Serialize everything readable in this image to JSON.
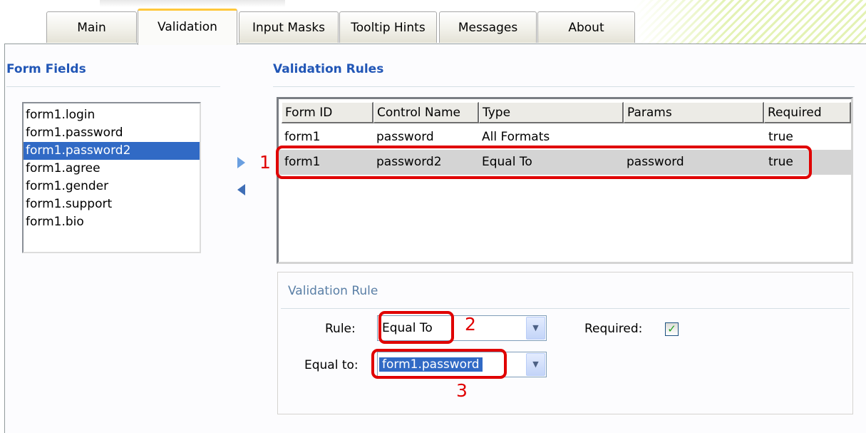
{
  "tabs": [
    "Main",
    "Validation",
    "Input Masks",
    "Tooltip Hints",
    "Messages",
    "About"
  ],
  "active_tab": "Validation",
  "form_fields": {
    "title": "Form Fields",
    "items": [
      "form1.login",
      "form1.password",
      "form1.password2",
      "form1.agree",
      "form1.gender",
      "form1.support",
      "form1.bio"
    ],
    "selected": "form1.password2"
  },
  "validation_rules": {
    "title": "Validation Rules",
    "columns": [
      "Form ID",
      "Control Name",
      "Type",
      "Params",
      "Required"
    ],
    "rows": [
      {
        "form_id": "form1",
        "control_name": "password",
        "type": "All Formats",
        "params": "",
        "required": "true"
      },
      {
        "form_id": "form1",
        "control_name": "password2",
        "type": "Equal To",
        "params": "password",
        "required": "true"
      }
    ],
    "selected_row": 1
  },
  "rule_editor": {
    "title": "Validation Rule",
    "rule_label": "Rule:",
    "rule_value": "Equal To",
    "required_label": "Required:",
    "required_checked": true,
    "equal_to_label": "Equal to:",
    "equal_to_value": "form1.password"
  },
  "annotations": [
    "1",
    "2",
    "3"
  ],
  "icons": {
    "add": "arrow-right-icon",
    "remove": "arrow-left-icon",
    "dropdown": "chevron-down-icon",
    "check": "checkmark-icon"
  },
  "colors": {
    "section_title": "#2156b6",
    "selection": "#316ac5",
    "annotation": "#e00000",
    "active_tab_accent": "#ffc83c"
  }
}
